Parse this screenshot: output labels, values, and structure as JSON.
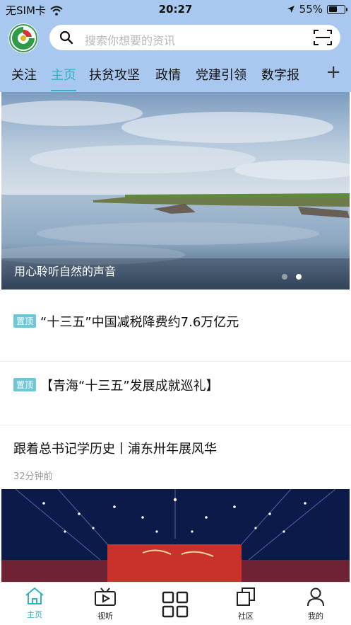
{
  "status_bar": {
    "carrier": "无SIM卡",
    "time": "20:27",
    "battery": "55%",
    "battery_level": 0.55,
    "icons": [
      "wifi-icon",
      "location-arrow-icon",
      "battery-icon"
    ]
  },
  "search": {
    "placeholder": "搜索你想要的资讯"
  },
  "tabs": [
    {
      "label": "关注",
      "active": false
    },
    {
      "label": "主页",
      "active": true
    },
    {
      "label": "扶贫攻坚",
      "active": false
    },
    {
      "label": "政情",
      "active": false
    },
    {
      "label": "党建引领",
      "active": false
    },
    {
      "label": "数字报",
      "active": false
    }
  ],
  "add_tab_label": "+",
  "banner": {
    "caption": "用心聆听自然的声音",
    "slide_count": 2,
    "active_slide": 2
  },
  "news": [
    {
      "pinned": true,
      "pin_label": "置顶",
      "title": "“十三五”中国减税降费约7.6万亿元"
    },
    {
      "pinned": true,
      "pin_label": "置顶",
      "title": "【青海“十三五”发展成就巡礼】"
    },
    {
      "pinned": false,
      "title": "跟着总书记学历史丨浦东卅年展风华",
      "time": "32分钟前"
    }
  ],
  "bottom_nav": [
    {
      "label": "主页",
      "icon": "home-icon",
      "active": true
    },
    {
      "label": "视听",
      "icon": "video-icon",
      "active": false
    },
    {
      "label": "",
      "icon": "grid-icon",
      "active": false
    },
    {
      "label": "社区",
      "icon": "community-icon",
      "active": false
    },
    {
      "label": "我的",
      "icon": "user-icon",
      "active": false
    }
  ],
  "colors": {
    "header_bg": "#a9c8ef",
    "accent": "#2db3c4",
    "pin_badge": "#6fc6d6"
  }
}
